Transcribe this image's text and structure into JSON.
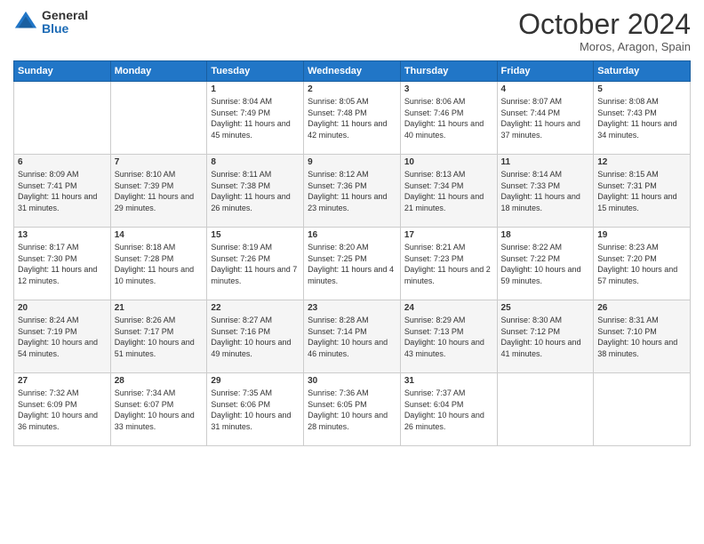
{
  "logo": {
    "general": "General",
    "blue": "Blue"
  },
  "title": "October 2024",
  "location": "Moros, Aragon, Spain",
  "days_header": [
    "Sunday",
    "Monday",
    "Tuesday",
    "Wednesday",
    "Thursday",
    "Friday",
    "Saturday"
  ],
  "weeks": [
    [
      {
        "day": "",
        "content": ""
      },
      {
        "day": "",
        "content": ""
      },
      {
        "day": "1",
        "content": "Sunrise: 8:04 AM\nSunset: 7:49 PM\nDaylight: 11 hours and 45 minutes."
      },
      {
        "day": "2",
        "content": "Sunrise: 8:05 AM\nSunset: 7:48 PM\nDaylight: 11 hours and 42 minutes."
      },
      {
        "day": "3",
        "content": "Sunrise: 8:06 AM\nSunset: 7:46 PM\nDaylight: 11 hours and 40 minutes."
      },
      {
        "day": "4",
        "content": "Sunrise: 8:07 AM\nSunset: 7:44 PM\nDaylight: 11 hours and 37 minutes."
      },
      {
        "day": "5",
        "content": "Sunrise: 8:08 AM\nSunset: 7:43 PM\nDaylight: 11 hours and 34 minutes."
      }
    ],
    [
      {
        "day": "6",
        "content": "Sunrise: 8:09 AM\nSunset: 7:41 PM\nDaylight: 11 hours and 31 minutes."
      },
      {
        "day": "7",
        "content": "Sunrise: 8:10 AM\nSunset: 7:39 PM\nDaylight: 11 hours and 29 minutes."
      },
      {
        "day": "8",
        "content": "Sunrise: 8:11 AM\nSunset: 7:38 PM\nDaylight: 11 hours and 26 minutes."
      },
      {
        "day": "9",
        "content": "Sunrise: 8:12 AM\nSunset: 7:36 PM\nDaylight: 11 hours and 23 minutes."
      },
      {
        "day": "10",
        "content": "Sunrise: 8:13 AM\nSunset: 7:34 PM\nDaylight: 11 hours and 21 minutes."
      },
      {
        "day": "11",
        "content": "Sunrise: 8:14 AM\nSunset: 7:33 PM\nDaylight: 11 hours and 18 minutes."
      },
      {
        "day": "12",
        "content": "Sunrise: 8:15 AM\nSunset: 7:31 PM\nDaylight: 11 hours and 15 minutes."
      }
    ],
    [
      {
        "day": "13",
        "content": "Sunrise: 8:17 AM\nSunset: 7:30 PM\nDaylight: 11 hours and 12 minutes."
      },
      {
        "day": "14",
        "content": "Sunrise: 8:18 AM\nSunset: 7:28 PM\nDaylight: 11 hours and 10 minutes."
      },
      {
        "day": "15",
        "content": "Sunrise: 8:19 AM\nSunset: 7:26 PM\nDaylight: 11 hours and 7 minutes."
      },
      {
        "day": "16",
        "content": "Sunrise: 8:20 AM\nSunset: 7:25 PM\nDaylight: 11 hours and 4 minutes."
      },
      {
        "day": "17",
        "content": "Sunrise: 8:21 AM\nSunset: 7:23 PM\nDaylight: 11 hours and 2 minutes."
      },
      {
        "day": "18",
        "content": "Sunrise: 8:22 AM\nSunset: 7:22 PM\nDaylight: 10 hours and 59 minutes."
      },
      {
        "day": "19",
        "content": "Sunrise: 8:23 AM\nSunset: 7:20 PM\nDaylight: 10 hours and 57 minutes."
      }
    ],
    [
      {
        "day": "20",
        "content": "Sunrise: 8:24 AM\nSunset: 7:19 PM\nDaylight: 10 hours and 54 minutes."
      },
      {
        "day": "21",
        "content": "Sunrise: 8:26 AM\nSunset: 7:17 PM\nDaylight: 10 hours and 51 minutes."
      },
      {
        "day": "22",
        "content": "Sunrise: 8:27 AM\nSunset: 7:16 PM\nDaylight: 10 hours and 49 minutes."
      },
      {
        "day": "23",
        "content": "Sunrise: 8:28 AM\nSunset: 7:14 PM\nDaylight: 10 hours and 46 minutes."
      },
      {
        "day": "24",
        "content": "Sunrise: 8:29 AM\nSunset: 7:13 PM\nDaylight: 10 hours and 43 minutes."
      },
      {
        "day": "25",
        "content": "Sunrise: 8:30 AM\nSunset: 7:12 PM\nDaylight: 10 hours and 41 minutes."
      },
      {
        "day": "26",
        "content": "Sunrise: 8:31 AM\nSunset: 7:10 PM\nDaylight: 10 hours and 38 minutes."
      }
    ],
    [
      {
        "day": "27",
        "content": "Sunrise: 7:32 AM\nSunset: 6:09 PM\nDaylight: 10 hours and 36 minutes."
      },
      {
        "day": "28",
        "content": "Sunrise: 7:34 AM\nSunset: 6:07 PM\nDaylight: 10 hours and 33 minutes."
      },
      {
        "day": "29",
        "content": "Sunrise: 7:35 AM\nSunset: 6:06 PM\nDaylight: 10 hours and 31 minutes."
      },
      {
        "day": "30",
        "content": "Sunrise: 7:36 AM\nSunset: 6:05 PM\nDaylight: 10 hours and 28 minutes."
      },
      {
        "day": "31",
        "content": "Sunrise: 7:37 AM\nSunset: 6:04 PM\nDaylight: 10 hours and 26 minutes."
      },
      {
        "day": "",
        "content": ""
      },
      {
        "day": "",
        "content": ""
      }
    ]
  ]
}
